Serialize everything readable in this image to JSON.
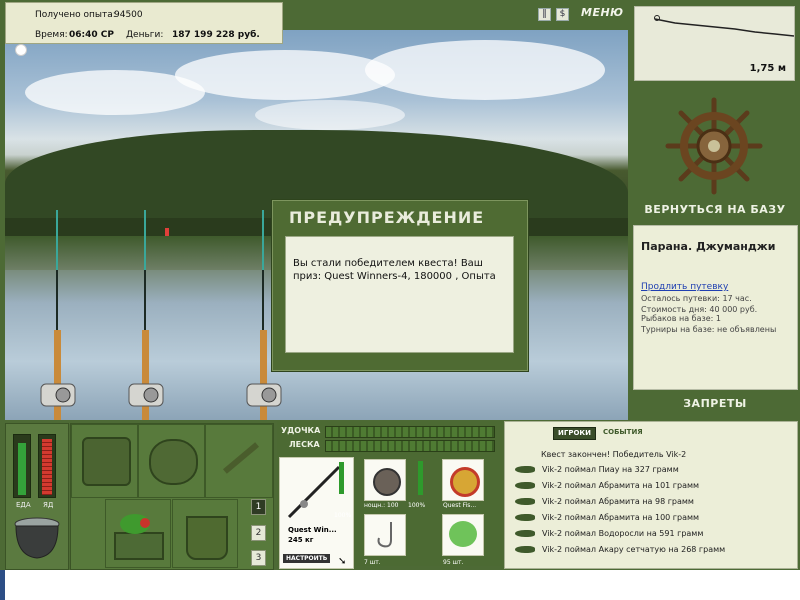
{
  "stats": {
    "exp_label": "Получено опыта:",
    "exp_value": "94500",
    "time_label": "Время:",
    "time_value": "06:40 СР",
    "money_label": "Деньги:",
    "money_value": "187 199 228 руб."
  },
  "topbar": {
    "pause_icon": "pause-icon",
    "stats_icon": "dollar-icon",
    "menu_label": "МЕНЮ"
  },
  "depth": {
    "value": "1,75 м"
  },
  "right_panel": {
    "return_label": "ВЕРНУТЬСЯ НА БАЗУ",
    "location": "Парана. Джуманджи",
    "extend_link": "Продлить путевку",
    "lines": [
      "Осталось путевки: 17 час.",
      "Стоимость дня: 40 000 руб.",
      "Рыбаков на базе: 1",
      "Турниры на базе: не объявлены"
    ],
    "bans_label": "ЗАПРЕТЫ"
  },
  "dialog": {
    "title": "ПРЕДУПРЕЖДЕНИЕ",
    "message": "Вы стали победителем квеста! Ваш приз: Quest Winners-4, 180000 , Опыта"
  },
  "meters": {
    "food_label": "ЕДА",
    "poison_label": "ЯД",
    "rod_label": "УДОЧКА",
    "line_label": "ЛЕСКА"
  },
  "tackle": {
    "rod_name": "Quest Win...",
    "rod_weight": "245 кг",
    "rod_percent": "100%",
    "reel_label": "нощн.: 100",
    "reel_percent": "100%",
    "line_name": "Quest Fis...",
    "hook_count": "7 шт.",
    "bait_count": "95 шт.",
    "setup_label": "НАСТРОИТЬ"
  },
  "slots": [
    "1",
    "2",
    "3"
  ],
  "events": {
    "tab_players": "ИГРОКИ",
    "tab_events": "СОБЫТИЯ",
    "header": "Квест закончен! Победитель Vik-2",
    "items": [
      "Vik-2 поймал Пиау на 327 грамм",
      "Vik-2 поймал Абрамита на 101 грамм",
      "Vik-2 поймал Абрамита на 98 грамм",
      "Vik-2 поймал Абрамита на 100 грамм",
      "Vik-2 поймал Водоросли на 591 грамм",
      "Vik-2 поймал Акару сетчатую на 268 грамм"
    ]
  },
  "colors": {
    "panel_green": "#4d6a35",
    "meter_green": "#2e9a2c",
    "meter_red": "#c8342b",
    "link_blue": "#1f3fb1"
  }
}
